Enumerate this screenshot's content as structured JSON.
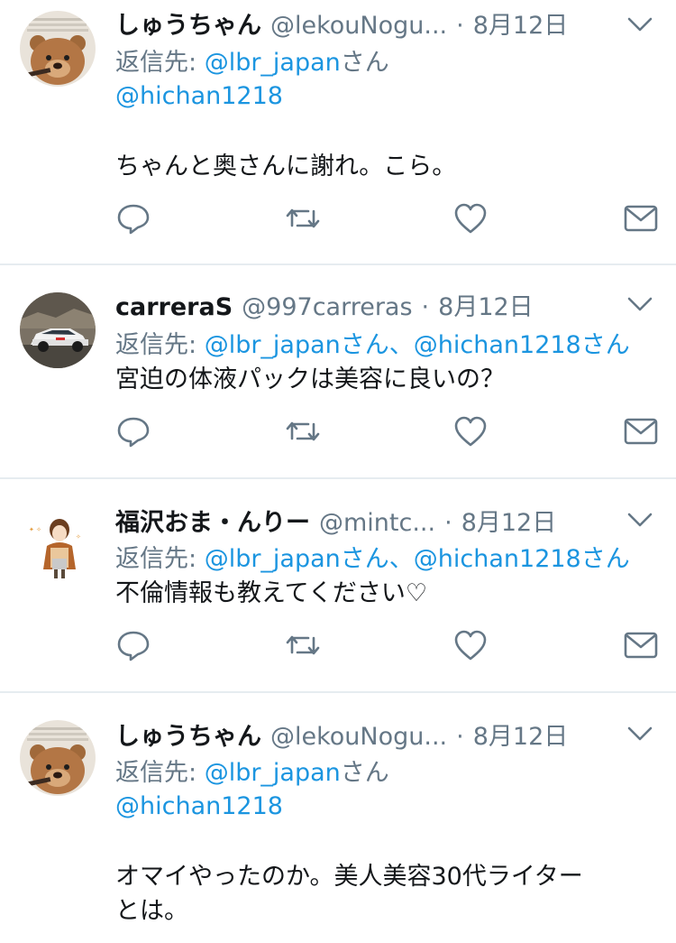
{
  "colors": {
    "link": "#1b95e0",
    "muted": "#657786",
    "text": "#14171a",
    "divider": "#e6ecf0"
  },
  "tweets": [
    {
      "name": "しゅうちゃん",
      "handle": "@lekouNogu...",
      "dot": "·",
      "time": "8月12日",
      "reply_prefix": "返信先: ",
      "reply_line1": [
        {
          "text": "@lbr_japan",
          "type": "mention"
        },
        {
          "text": "さん",
          "type": "plain"
        }
      ],
      "reply_line2": [
        {
          "text": "@hichan1218",
          "type": "mention"
        }
      ],
      "body_lines": [
        "ちゃんと奥さんに謝れ。こら。"
      ],
      "avatar": "teddy-bear-avatar"
    },
    {
      "name": "carreraS",
      "handle": "@997carreras",
      "dot": "·",
      "time": "8月12日",
      "reply_prefix": "返信先: ",
      "reply_line1": [
        {
          "text": "@lbr_japan",
          "type": "mention"
        },
        {
          "text": "さん、",
          "type": "plain"
        },
        {
          "text": "@hichan1218",
          "type": "mention"
        },
        {
          "text": "さん",
          "type": "mention"
        }
      ],
      "reply_line2": [],
      "body_lines": [
        "宮迫の体液パックは美容に良いの？"
      ],
      "avatar": "sports-car-avatar"
    },
    {
      "name": "福沢おま・んりー",
      "handle": "@mintc...",
      "dot": "·",
      "time": "8月12日",
      "reply_prefix": "返信先: ",
      "reply_line1": [
        {
          "text": "@lbr_japan",
          "type": "mention"
        },
        {
          "text": "さん、",
          "type": "plain"
        },
        {
          "text": "@hichan1218",
          "type": "mention"
        },
        {
          "text": "さん",
          "type": "mention"
        }
      ],
      "reply_line2": [],
      "body_lines": [
        "不倫情報も教えてください♡"
      ],
      "avatar": "anime-girl-avatar"
    },
    {
      "name": "しゅうちゃん",
      "handle": "@lekouNogu...",
      "dot": "·",
      "time": "8月12日",
      "reply_prefix": "返信先: ",
      "reply_line1": [
        {
          "text": "@lbr_japan",
          "type": "mention"
        },
        {
          "text": "さん",
          "type": "plain"
        }
      ],
      "reply_line2": [
        {
          "text": "@hichan1218",
          "type": "mention"
        }
      ],
      "body_lines": [
        "オマイやったのか。美人美容30代ライター",
        "とは。"
      ],
      "avatar": "teddy-bear-avatar"
    }
  ],
  "icons": {
    "reply": "reply-icon",
    "retweet": "retweet-icon",
    "like": "like-icon",
    "dm": "direct-message-icon",
    "menu": "chevron-down-icon"
  }
}
